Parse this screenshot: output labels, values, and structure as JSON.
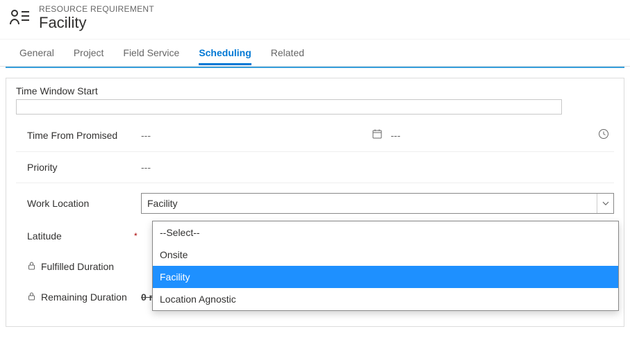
{
  "header": {
    "breadcrumb": "RESOURCE REQUIREMENT",
    "title": "Facility"
  },
  "tabs": {
    "items": [
      "General",
      "Project",
      "Field Service",
      "Scheduling",
      "Related"
    ],
    "active_index": 3
  },
  "form": {
    "time_window_start": {
      "label": "Time Window Start",
      "value": ""
    },
    "time_from_promised": {
      "label": "Time From Promised",
      "value_left": "---",
      "value_right": "---"
    },
    "priority": {
      "label": "Priority",
      "value": "---"
    },
    "work_location": {
      "label": "Work Location",
      "selected": "Facility",
      "options": [
        "--Select--",
        "Onsite",
        "Facility",
        "Location Agnostic"
      ],
      "highlight_index": 2
    },
    "latitude": {
      "label": "Latitude",
      "required": true
    },
    "fulfilled_duration": {
      "label": "Fulfilled Duration"
    },
    "remaining_duration": {
      "label": "Remaining Duration",
      "obscured_value": "0 minutes"
    }
  },
  "icons": {
    "calendar": "calendar",
    "clock": "clock",
    "lock": "lock",
    "chevron": "chevron"
  }
}
